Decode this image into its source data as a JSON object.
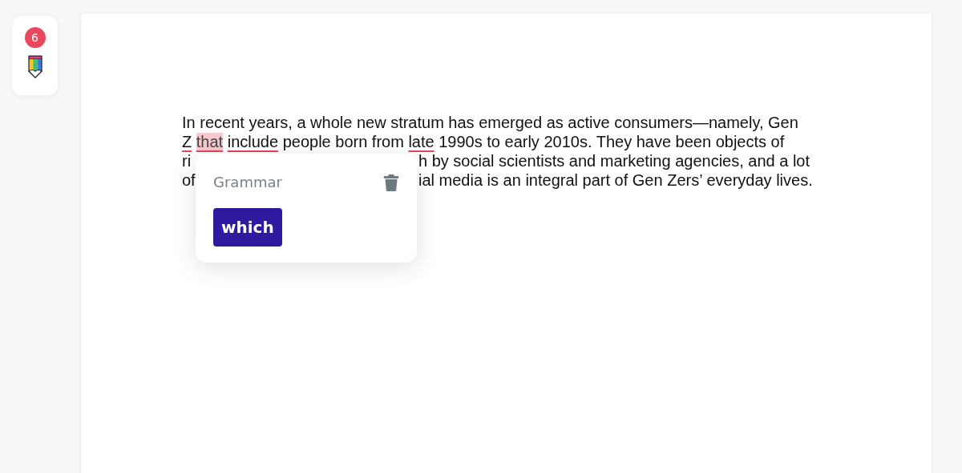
{
  "sidebar": {
    "badge": "6"
  },
  "document": {
    "lines": [
      {
        "kind": "full",
        "segments": [
          {
            "text": "In recent years, a whole new stratum has emerged as active consumers—namely, Gen",
            "kind": "plain"
          }
        ]
      },
      {
        "kind": "full",
        "segments": [
          {
            "text": "Z",
            "kind": "error"
          },
          {
            "text": "that",
            "kind": "active"
          },
          {
            "text": "include",
            "kind": "error"
          },
          {
            "text": "people born from",
            "kind": "plain"
          },
          {
            "text": "late",
            "kind": "error"
          },
          {
            "text": "1990s to early 2010s. They have been objects of",
            "kind": "plain"
          }
        ]
      },
      {
        "kind": "split",
        "left": "ri",
        "right": "h by social scientists and marketing agencies, and a lot"
      },
      {
        "kind": "split",
        "left": "of",
        "right": "ial media is an integral part of Gen Zers’ everyday lives."
      }
    ]
  },
  "popup": {
    "category": "Grammar",
    "suggestion": "which"
  }
}
